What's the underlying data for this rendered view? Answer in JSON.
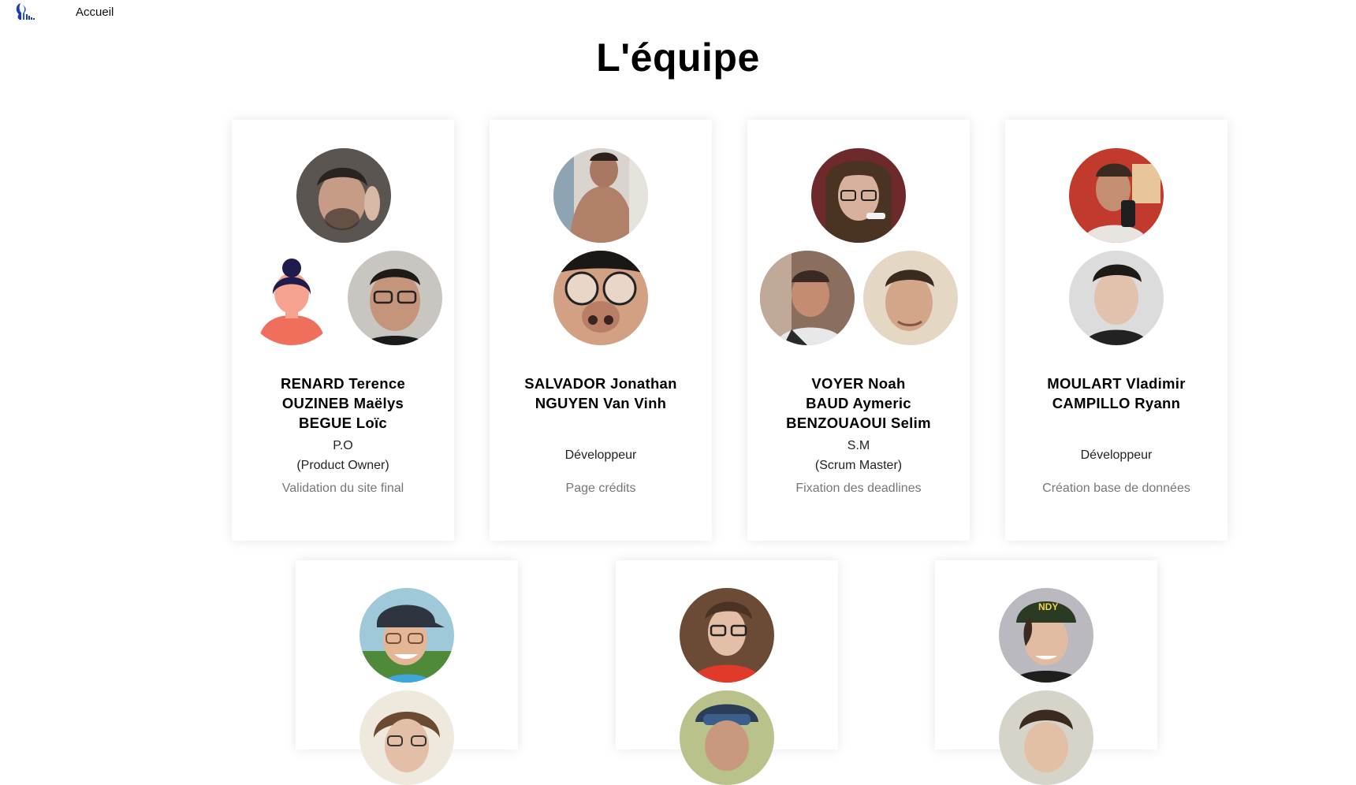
{
  "nav": {
    "home_label": "Accueil"
  },
  "page": {
    "title": "L'équipe"
  },
  "colors": {
    "accent": "#1a3bb8",
    "card_bg": "#ffffff",
    "task_text": "#777777"
  },
  "team": [
    {
      "names": [
        "RENARD Terence",
        "OUZINEB Maëlys",
        "BEGUE Loïc"
      ],
      "role_lines": [
        "P.O",
        "(Product Owner)"
      ],
      "task": "Validation du site final"
    },
    {
      "names": [
        "SALVADOR Jonathan",
        "NGUYEN Van Vinh"
      ],
      "role_lines": [
        "Développeur"
      ],
      "task": "Page crédits"
    },
    {
      "names": [
        "VOYER Noah",
        "BAUD Aymeric",
        "BENZOUAOUI Selim"
      ],
      "role_lines": [
        "S.M",
        "(Scrum Master)"
      ],
      "task": "Fixation des deadlines"
    },
    {
      "names": [
        "MOULART Vladimir",
        "CAMPILLO Ryann"
      ],
      "role_lines": [
        "Développeur"
      ],
      "task": "Création base de données"
    },
    {
      "names": [],
      "role_lines": [],
      "task": ""
    },
    {
      "names": [],
      "role_lines": [],
      "task": ""
    },
    {
      "names": [],
      "role_lines": [],
      "task": ""
    }
  ]
}
